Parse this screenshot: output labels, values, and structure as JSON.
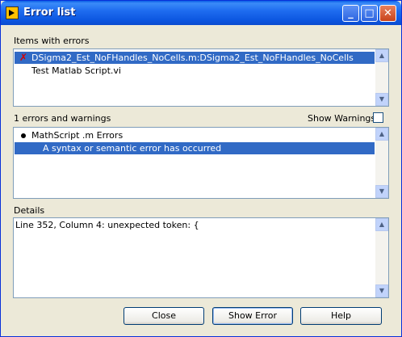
{
  "window": {
    "title": "Error list"
  },
  "items_with_errors": {
    "label": "Items with errors",
    "items": [
      {
        "text": "DSigma2_Est_NoFHandles_NoCells.m:DSigma2_Est_NoFHandles_NoCells",
        "icon": "error-x-icon",
        "selected": true
      },
      {
        "text": "Test Matlab Script.vi",
        "selected": false
      }
    ]
  },
  "errors_warnings": {
    "count_label": "1 errors and warnings",
    "show_warnings_label": "Show Warnings",
    "show_warnings_checked": false,
    "items": [
      {
        "text": "MathScript .m Errors",
        "icon": "bullet-icon",
        "selected": false
      },
      {
        "text": "A syntax or semantic error has occurred",
        "selected": true
      }
    ]
  },
  "details": {
    "label": "Details",
    "text": "Line 352, Column 4: unexpected token: {"
  },
  "buttons": {
    "close": "Close",
    "show_error": "Show Error",
    "help": "Help"
  }
}
